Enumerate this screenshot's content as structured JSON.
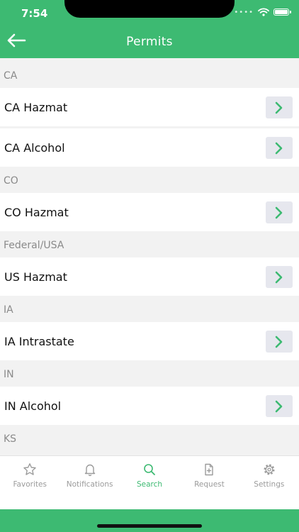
{
  "status_bar": {
    "time": "7:54",
    "dots": "••••"
  },
  "header": {
    "title": "Permits"
  },
  "sections": [
    {
      "header": "CA",
      "items": [
        {
          "label": "CA Hazmat"
        },
        {
          "label": "CA Alcohol"
        }
      ]
    },
    {
      "header": "CO",
      "items": [
        {
          "label": "CO Hazmat"
        }
      ]
    },
    {
      "header": "Federal/USA",
      "items": [
        {
          "label": "US Hazmat"
        }
      ]
    },
    {
      "header": "IA",
      "items": [
        {
          "label": "IA Intrastate"
        }
      ]
    },
    {
      "header": "IN",
      "items": [
        {
          "label": "IN Alcohol"
        }
      ]
    },
    {
      "header": "KS",
      "items": []
    }
  ],
  "tabs": [
    {
      "label": "Favorites",
      "icon": "star-icon"
    },
    {
      "label": "Notifications",
      "icon": "bell-icon"
    },
    {
      "label": "Search",
      "icon": "search-icon",
      "active": true
    },
    {
      "label": "Request",
      "icon": "document-add-icon"
    },
    {
      "label": "Settings",
      "icon": "gear-icon"
    }
  ],
  "colors": {
    "brand": "#3dba72",
    "chevron_button_bg": "#e6e7ee",
    "inactive_tab": "#9b9b9b"
  }
}
